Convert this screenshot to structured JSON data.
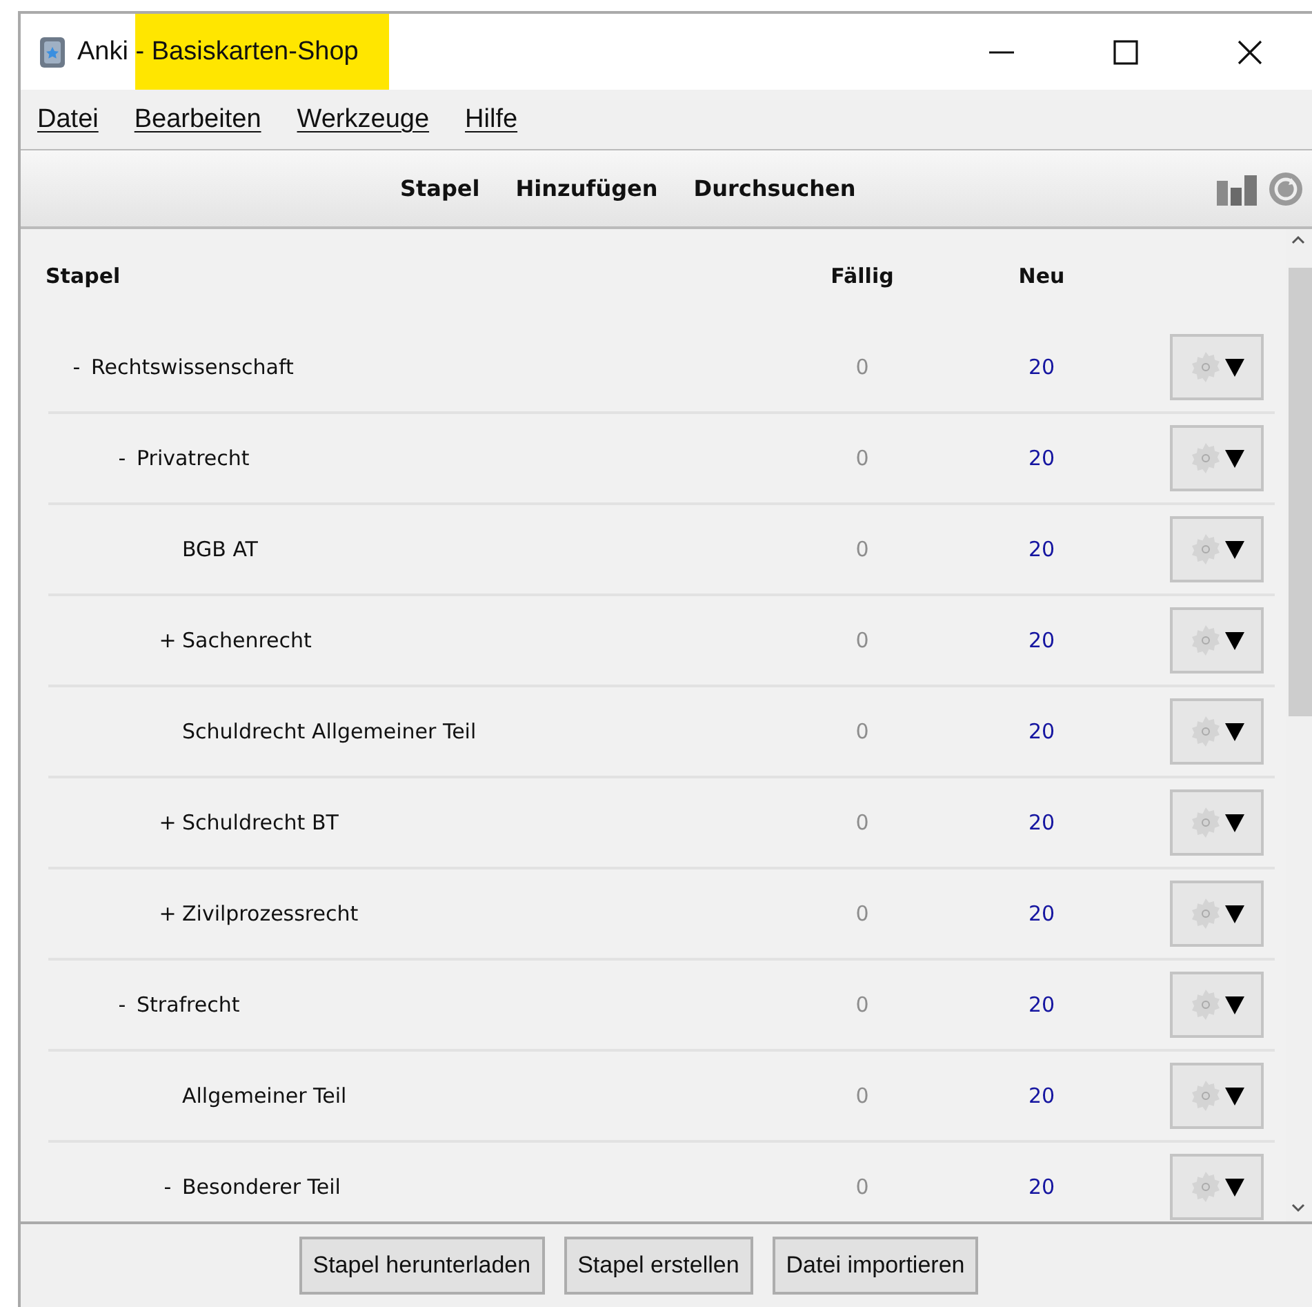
{
  "window": {
    "app": "Anki",
    "title": "- Basiskarten-Shop",
    "title_highlighted": true
  },
  "menu": [
    {
      "label": "Datei"
    },
    {
      "label": "Bearbeiten"
    },
    {
      "label": "Werkzeuge"
    },
    {
      "label": "Hilfe"
    }
  ],
  "toolbar": [
    "Stapel",
    "Hinzufügen",
    "Durchsuchen"
  ],
  "table": {
    "columns": [
      "Stapel",
      "Fällig",
      "Neu"
    ],
    "rows": [
      {
        "toggle": "-",
        "name": "Rechtswissenschaft",
        "due": "0",
        "new": "20",
        "children": [
          {
            "toggle": "-",
            "name": "Privatrecht",
            "due": "0",
            "new": "20",
            "children": [
              {
                "name": "BGB AT",
                "due": "0",
                "new": "20"
              },
              {
                "toggle": "+",
                "name": "Sachenrecht",
                "due": "0",
                "new": "20"
              },
              {
                "name": "Schuldrecht Allgemeiner Teil",
                "due": "0",
                "new": "20"
              },
              {
                "toggle": "+",
                "name": "Schuldrecht BT",
                "due": "0",
                "new": "20"
              },
              {
                "toggle": "+",
                "name": "Zivilprozessrecht",
                "due": "0",
                "new": "20"
              }
            ]
          },
          {
            "toggle": "-",
            "name": "Strafrecht",
            "due": "0",
            "new": "20",
            "children": [
              {
                "name": "Allgemeiner Teil",
                "due": "0",
                "new": "20"
              },
              {
                "toggle": "-",
                "name": "Besonderer Teil",
                "due": "0",
                "new": "20"
              }
            ]
          }
        ]
      }
    ]
  },
  "bottom_buttons": [
    "Stapel herunterladen",
    "Stapel erstellen",
    "Datei importieren"
  ]
}
